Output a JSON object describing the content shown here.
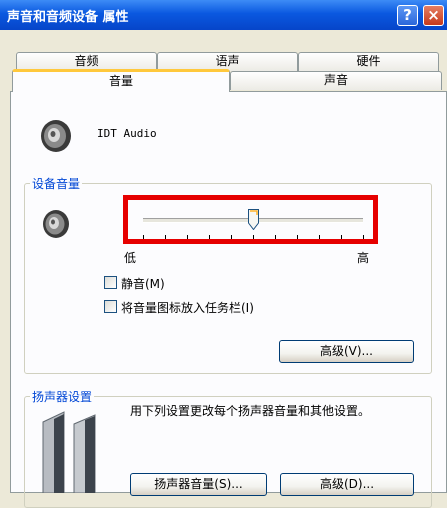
{
  "window": {
    "title": "声音和音频设备 属性",
    "help_glyph": "?",
    "close_glyph": "×"
  },
  "tabs": {
    "row1": [
      "音频",
      "语声",
      "硬件"
    ],
    "row2": [
      "音量",
      "声音"
    ],
    "active": "音量"
  },
  "device": {
    "name": "IDT Audio",
    "icon": "speaker-icon"
  },
  "device_volume": {
    "legend": "设备音量",
    "slider_level": 0.5,
    "low_label": "低",
    "high_label": "高",
    "mute_label": "静音(M)",
    "mute_checked": false,
    "tray_icon_label": "将音量图标放入任务栏(I)",
    "tray_icon_checked": false,
    "advanced_button": "高级(V)..."
  },
  "speaker_settings": {
    "legend": "扬声器设置",
    "description": "用下列设置更改每个扬声器音量和其他设置。",
    "volume_button": "扬声器音量(S)...",
    "advanced_button": "高级(D)...",
    "icon": "speakers-icon"
  },
  "colors": {
    "highlight_box": "#E60000",
    "legend_text": "#0046D5",
    "title_bar": "#0A58E0"
  }
}
